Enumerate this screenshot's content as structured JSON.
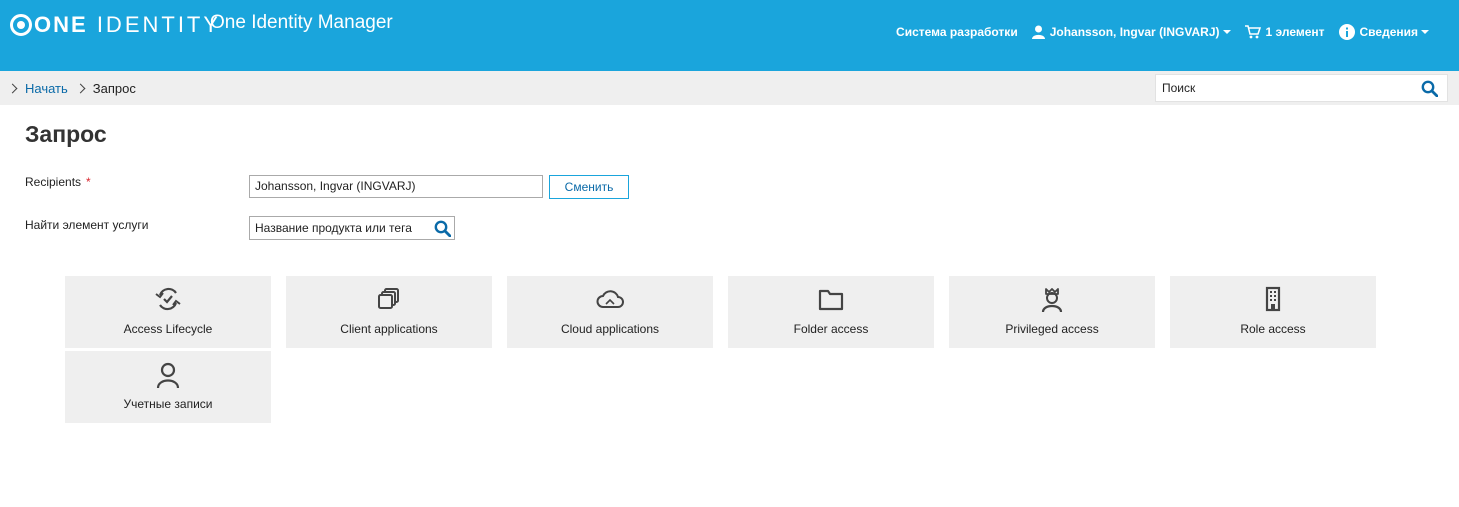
{
  "header": {
    "logo_one": "ONE",
    "logo_identity": "IDENTITY",
    "app_title": "One Identity Manager",
    "system": "Система разработки",
    "user": "Johansson, Ingvar (INGVARJ)",
    "cart": "1 элемент",
    "info": "Сведения"
  },
  "breadcrumb": {
    "home": "Начать",
    "current": "Запрос"
  },
  "search": {
    "placeholder": "Поиск"
  },
  "main": {
    "title": "Запрос",
    "recipients_label": "Recipients",
    "required_mark": "*",
    "recipients_value": "Johansson, Ingvar (INGVARJ)",
    "change_button": "Сменить",
    "find_label": "Найти элемент услуги",
    "find_placeholder": "Название продукта или тега"
  },
  "tiles": [
    {
      "label": "Access Lifecycle",
      "icon": "lifecycle-icon"
    },
    {
      "label": "Client applications",
      "icon": "apps-icon"
    },
    {
      "label": "Cloud applications",
      "icon": "cloud-icon"
    },
    {
      "label": "Folder access",
      "icon": "folder-icon"
    },
    {
      "label": "Privileged access",
      "icon": "privileged-icon"
    },
    {
      "label": "Role access",
      "icon": "building-icon"
    },
    {
      "label": "Учетные записи",
      "icon": "person-icon"
    }
  ],
  "colors": {
    "header": "#1aa5dc",
    "link": "#0a6aa8",
    "tile": "#efefef",
    "required": "#d9262e"
  }
}
